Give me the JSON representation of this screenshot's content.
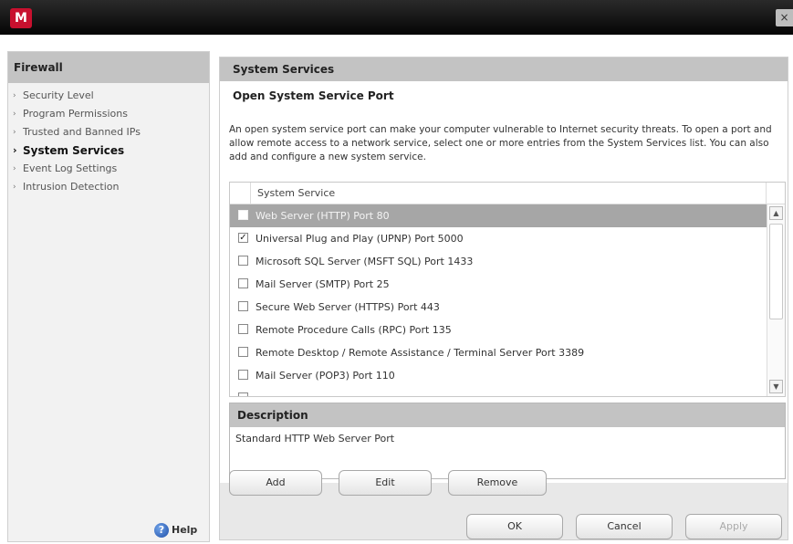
{
  "window": {
    "logo_letter": "M",
    "close_glyph": "×"
  },
  "sidebar": {
    "title": "Firewall",
    "items": [
      {
        "label": "Security Level",
        "name": "sidebar-item-security-level",
        "active": false
      },
      {
        "label": "Program Permissions",
        "name": "sidebar-item-program-permissions",
        "active": false
      },
      {
        "label": "Trusted and Banned IPs",
        "name": "sidebar-item-trusted-banned-ips",
        "active": false
      },
      {
        "label": "System Services",
        "name": "sidebar-item-system-services",
        "active": true
      },
      {
        "label": "Event Log Settings",
        "name": "sidebar-item-event-log-settings",
        "active": false
      },
      {
        "label": "Intrusion Detection",
        "name": "sidebar-item-intrusion-detection",
        "active": false
      }
    ],
    "help_label": "Help",
    "help_icon": "help-icon"
  },
  "main": {
    "header": "System Services",
    "subtitle": "Open System Service Port",
    "intro": "An open system service port can make your computer vulnerable to Internet security threats. To open a port and allow remote access to a network service, select one or more entries from the System Services list. You can also add and configure a new system service.",
    "list": {
      "column_header": "System Service",
      "rows": [
        {
          "label": "Web Server (HTTP) Port 80",
          "checked": false,
          "selected": true
        },
        {
          "label": "Universal Plug and Play (UPNP) Port 5000",
          "checked": true,
          "selected": false
        },
        {
          "label": "Microsoft SQL Server (MSFT SQL) Port 1433",
          "checked": false,
          "selected": false
        },
        {
          "label": "Mail Server (SMTP) Port 25",
          "checked": false,
          "selected": false
        },
        {
          "label": "Secure Web Server (HTTPS) Port 443",
          "checked": false,
          "selected": false
        },
        {
          "label": "Remote Procedure Calls (RPC) Port 135",
          "checked": false,
          "selected": false
        },
        {
          "label": "Remote Desktop / Remote Assistance / Terminal Server Port 3389",
          "checked": false,
          "selected": false
        },
        {
          "label": "Mail Server (POP3) Port 110",
          "checked": false,
          "selected": false
        },
        {
          "label": "",
          "checked": false,
          "selected": false
        }
      ]
    },
    "description": {
      "header": "Description",
      "text": "Standard HTTP Web Server Port"
    },
    "buttons": {
      "add": "Add",
      "edit": "Edit",
      "remove": "Remove"
    }
  },
  "footer": {
    "ok": "OK",
    "cancel": "Cancel",
    "apply": "Apply"
  }
}
